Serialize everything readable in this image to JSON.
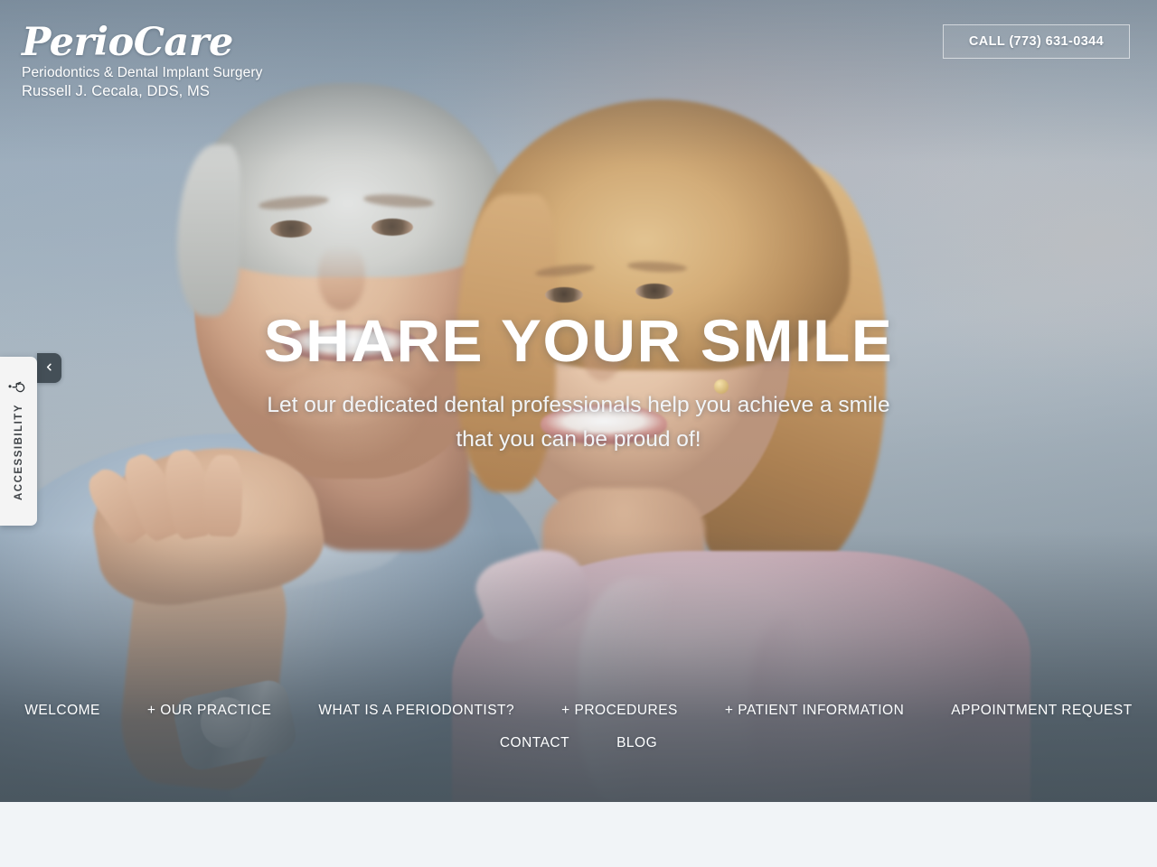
{
  "brand": {
    "name": "PerioCare",
    "tagline": "Periodontics & Dental Implant Surgery",
    "doctor": "Russell J. Cecala, DDS, MS"
  },
  "header": {
    "call_button_label": "CALL (773) 631-0344",
    "phone": "(773) 631-0344"
  },
  "hero": {
    "title": "SHARE YOUR SMILE",
    "subtitle_line1": "Let our dedicated dental professionals help you achieve a smile",
    "subtitle_line2": "that you can be proud of!"
  },
  "nav": {
    "row1": [
      {
        "label": "WELCOME",
        "name": "nav-item-welcome"
      },
      {
        "label": "+ OUR PRACTICE",
        "name": "nav-item-our-practice"
      },
      {
        "label": "WHAT IS A PERIODONTIST?",
        "name": "nav-item-what-is-a-periodontist"
      },
      {
        "label": "+ PROCEDURES",
        "name": "nav-item-procedures"
      },
      {
        "label": "+ PATIENT INFORMATION",
        "name": "nav-item-patient-information"
      },
      {
        "label": "APPOINTMENT REQUEST",
        "name": "nav-item-appointment-request"
      }
    ],
    "row2": [
      {
        "label": "CONTACT",
        "name": "nav-item-contact"
      },
      {
        "label": "BLOG",
        "name": "nav-item-blog"
      }
    ]
  },
  "accessibility_widget": {
    "label": "ACCESSIBILITY",
    "icon": "wheelchair-icon",
    "toggle_icon": "chevron-left-icon"
  },
  "colors": {
    "text_on_hero": "#ffffff",
    "page_background": "#f1f4f7",
    "widget_background": "#f4f4f4",
    "widget_text": "#404448",
    "widget_tab": "#444f57",
    "hero_scrim": "#404c55"
  }
}
